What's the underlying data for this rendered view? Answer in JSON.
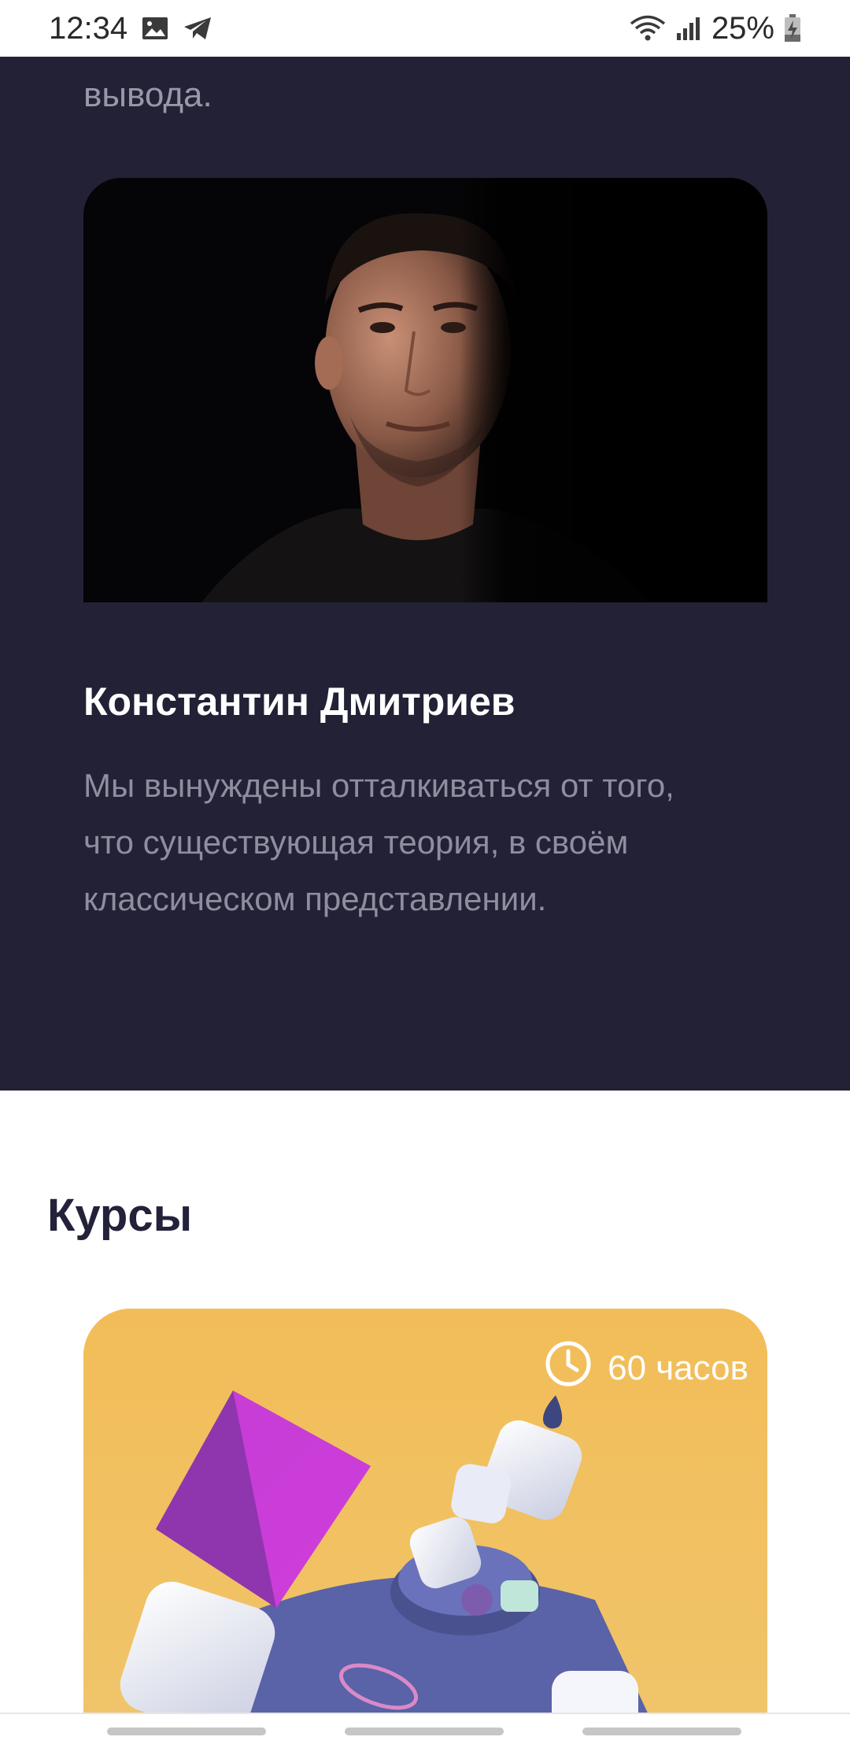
{
  "status_bar": {
    "time": "12:34",
    "battery": "25%",
    "icons": [
      "gallery-icon",
      "telegram-icon",
      "wifi-icon",
      "signal-icon",
      "battery-charging-icon"
    ]
  },
  "intro": {
    "text_tail": "вывода."
  },
  "teacher": {
    "photo_icon": "portrait-photo",
    "name": "Константин Дмитриев",
    "bio": "Мы вынуждены отталкиваться от того, что существующая теория, в своём классическом представлении."
  },
  "courses": {
    "heading": "Курсы",
    "items": [
      {
        "duration": "60 часов",
        "duration_icon": "clock-icon",
        "card_color": "#f2bd58"
      }
    ]
  },
  "colors": {
    "dark_background": "#222135",
    "heading_text": "#23223a",
    "muted_text": "#8f8d9f",
    "card_accent": "#f2bd58"
  }
}
